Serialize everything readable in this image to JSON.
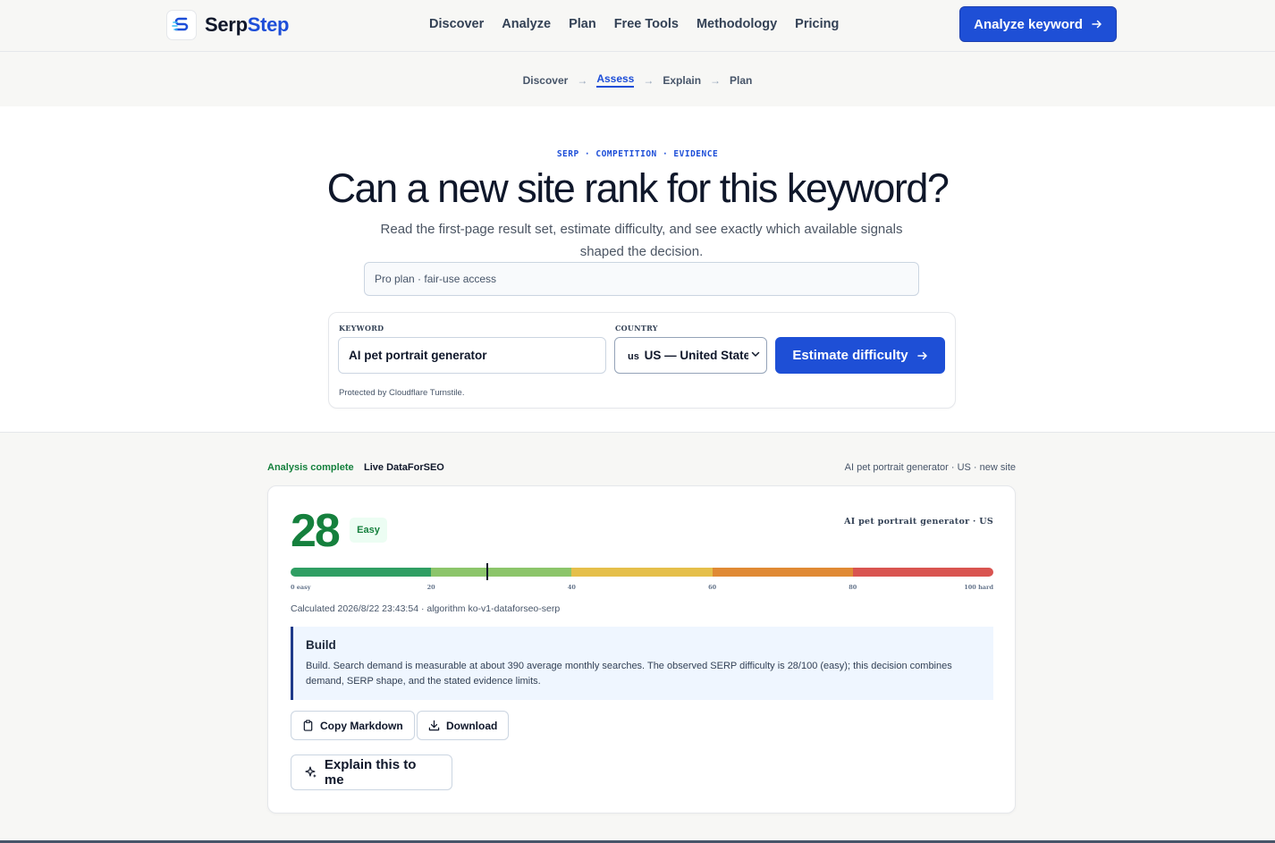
{
  "header": {
    "brand_prefix": "Serp",
    "brand_suffix": "Step",
    "nav": [
      "Discover",
      "Analyze",
      "Plan",
      "Free Tools",
      "Methodology",
      "Pricing"
    ],
    "cta_label": "Analyze keyword"
  },
  "stepper": {
    "steps": [
      "Discover",
      "Assess",
      "Explain",
      "Plan"
    ],
    "arrow": "→",
    "active": "Assess"
  },
  "hero": {
    "eyebrow": "SERP · COMPETITION · EVIDENCE",
    "title": "Can a new site rank for this keyword?",
    "subtitle": "Read the first-page result set, estimate difficulty, and see exactly which available signals shaped the decision.",
    "plan_note": "Pro plan · fair-use access"
  },
  "form": {
    "keyword_label": "KEYWORD",
    "keyword_value": "AI pet portrait generator",
    "country_label": "COUNTRY",
    "country_code": "us",
    "country_value": "US — United States",
    "submit_label": "Estimate difficulty",
    "protected_note": "Protected by Cloudflare Turnstile."
  },
  "status": {
    "state": "Analysis complete",
    "source": "Live DataForSEO",
    "meta": "AI pet portrait generator · US · new site"
  },
  "result": {
    "score": "28",
    "score_value": 28,
    "level": "Easy",
    "keyword_meta": "AI pet portrait generator · US",
    "scale_colors": [
      "#2f9e63",
      "#8cc56a",
      "#e5bf4a",
      "#e08a34",
      "#d95450"
    ],
    "ticks": [
      "0 easy",
      "20",
      "40",
      "60",
      "80",
      "100 hard"
    ],
    "calculated": "Calculated 2026/8/22 23:43:54 · algorithm ko-v1-dataforseo-serp",
    "verdict_title": "Build",
    "verdict_text": "Build. Search demand is measurable at about 390 average monthly searches. The observed SERP difficulty is 28/100 (easy); this decision combines demand, SERP shape, and the stated evidence limits.",
    "copy_label": "Copy Markdown",
    "download_label": "Download",
    "explain_label": "Explain this to me"
  }
}
